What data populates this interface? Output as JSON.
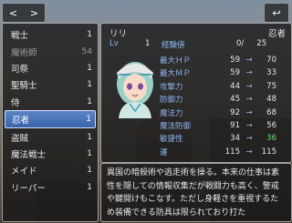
{
  "toolbar": {
    "prev_label": "<",
    "next_label": ">",
    "back_icon": "↩"
  },
  "classes": [
    {
      "name": "戦士",
      "level": "1",
      "dim": false
    },
    {
      "name": "魔術師",
      "level": "54",
      "dim": true
    },
    {
      "name": "司祭",
      "level": "1",
      "dim": false
    },
    {
      "name": "聖騎士",
      "level": "1",
      "dim": false
    },
    {
      "name": "侍",
      "level": "1",
      "dim": false
    },
    {
      "name": "忍者",
      "level": "1",
      "dim": false,
      "selected": true
    },
    {
      "name": "盗賊",
      "level": "1",
      "dim": false
    },
    {
      "name": "魔法戦士",
      "level": "1",
      "dim": false
    },
    {
      "name": "メイド",
      "level": "1",
      "dim": false
    },
    {
      "name": "リーパー",
      "level": "1",
      "dim": false
    }
  ],
  "character": {
    "name": "リリ",
    "class": "忍者",
    "lv_label": "Lv",
    "lv": "1",
    "exp_label": "経験値",
    "exp": "0/",
    "exp_next": "25"
  },
  "stats": [
    {
      "name": "最大ＨＰ",
      "current": "59",
      "next": "70",
      "up": false
    },
    {
      "name": "最大ＭＰ",
      "current": "59",
      "next": "33",
      "up": false
    },
    {
      "name": "攻撃力",
      "current": "44",
      "next": "75",
      "up": false
    },
    {
      "name": "防御力",
      "current": "45",
      "next": "48",
      "up": false
    },
    {
      "name": "魔法力",
      "current": "92",
      "next": "68",
      "up": false
    },
    {
      "name": "魔法防御",
      "current": "91",
      "next": "56",
      "up": false
    },
    {
      "name": "敏捷性",
      "current": "34",
      "next": "36",
      "up": true
    },
    {
      "name": "運",
      "current": "115",
      "next": "115",
      "up": false
    }
  ],
  "arrow": "→",
  "description": "異国の暗殺術や逃走術を操る。本来の仕事は素性を隠しての情報収集だが戦闘力も高く、警戒や鍵開けもこなす。ただし身軽さを重視するため装備できる防具は限られており打た"
}
